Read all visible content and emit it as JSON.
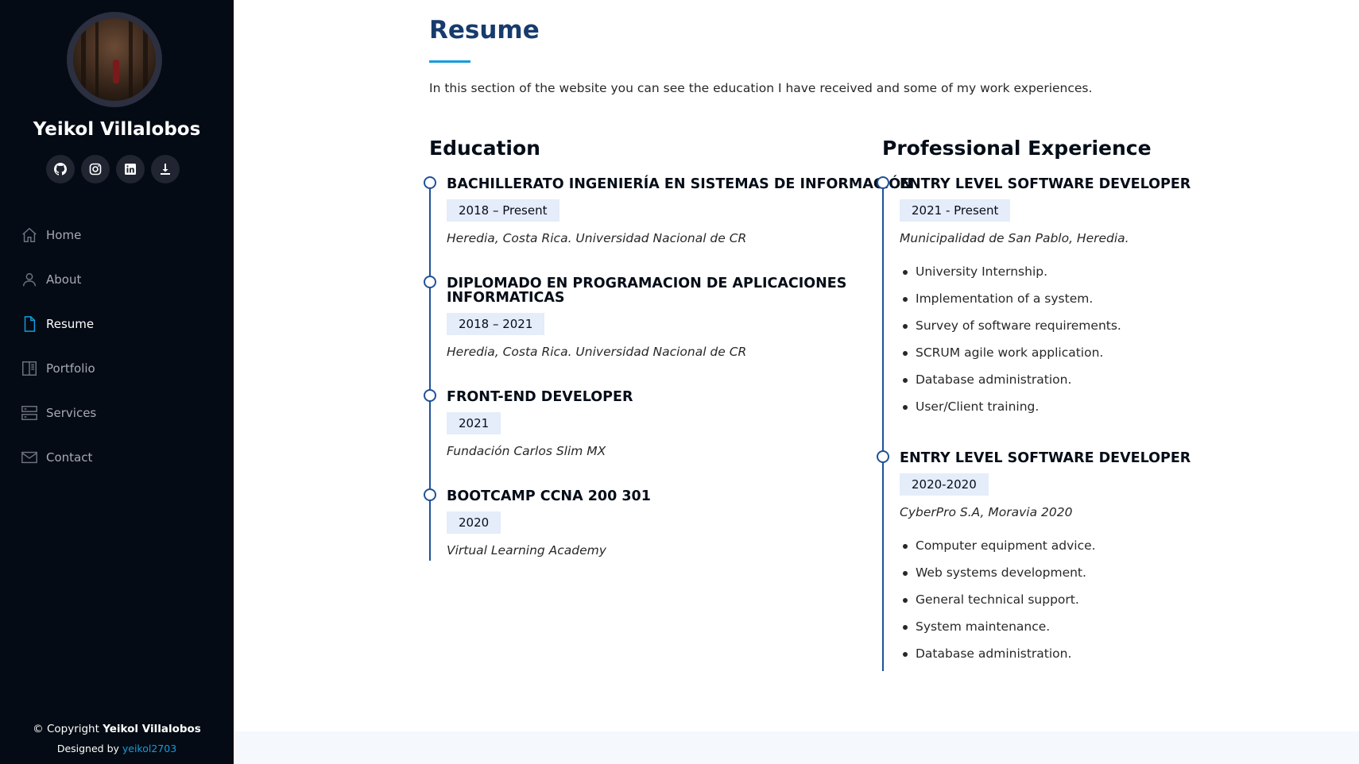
{
  "profile": {
    "name": "Yeikol Villalobos",
    "social": [
      "github-icon",
      "instagram-icon",
      "linkedin-icon",
      "download-icon"
    ]
  },
  "nav": {
    "items": [
      {
        "label": "Home",
        "icon": "home-icon"
      },
      {
        "label": "About",
        "icon": "person-icon"
      },
      {
        "label": "Resume",
        "icon": "file-icon",
        "active": true
      },
      {
        "label": "Portfolio",
        "icon": "book-icon"
      },
      {
        "label": "Services",
        "icon": "server-icon"
      },
      {
        "label": "Contact",
        "icon": "envelope-icon"
      }
    ]
  },
  "footer": {
    "copyright_prefix": "© Copyright ",
    "copyright_name": "Yeikol Villalobos",
    "designed_prefix": "Designed by ",
    "designed_link": "yeikol2703"
  },
  "resume": {
    "title": "Resume",
    "intro": "In this section of the website you can see the education I have received and some of my work experiences.",
    "education": {
      "heading": "Education",
      "items": [
        {
          "title_lines": [
            "BACHILLERATO INGENIERÍA EN SISTEMAS DE INFORMACIÓN"
          ],
          "date": "2018 – Present",
          "place": "Heredia, Costa Rica. Universidad Nacional de CR"
        },
        {
          "title_lines": [
            "DIPLOMADO EN PROGRAMACION DE APLICACIONES",
            "INFORMATICAS"
          ],
          "date": "2018 – 2021",
          "place": "Heredia, Costa Rica. Universidad Nacional de CR"
        },
        {
          "title_lines": [
            "FRONT-END DEVELOPER"
          ],
          "date": "2021",
          "place": "Fundación Carlos Slim MX"
        },
        {
          "title_lines": [
            "BOOTCAMP CCNA 200 301"
          ],
          "date": "2020",
          "place": "Virtual Learning Academy"
        }
      ]
    },
    "experience": {
      "heading": "Professional Experience",
      "items": [
        {
          "title": "ENTRY LEVEL SOFTWARE DEVELOPER",
          "date": "2021 - Present",
          "place": "Municipalidad de San Pablo, Heredia.",
          "bullets": [
            "University Internship.",
            "Implementation of a system.",
            "Survey of software requirements.",
            "SCRUM agile work application.",
            "Database administration.",
            "User/Client training."
          ]
        },
        {
          "title": "ENTRY LEVEL SOFTWARE DEVELOPER",
          "date": "2020-2020",
          "place": "CyberPro S.A, Moravia 2020",
          "bullets": [
            "Computer equipment advice.",
            "Web systems development.",
            "General technical support.",
            "System maintenance.",
            "Database administration."
          ]
        }
      ]
    }
  },
  "colors": {
    "sidebar_bg": "#040b14",
    "accent": "#149ddd",
    "title": "#173b6c",
    "timeline": "#1f5297",
    "date_bg": "#e4edf9"
  }
}
